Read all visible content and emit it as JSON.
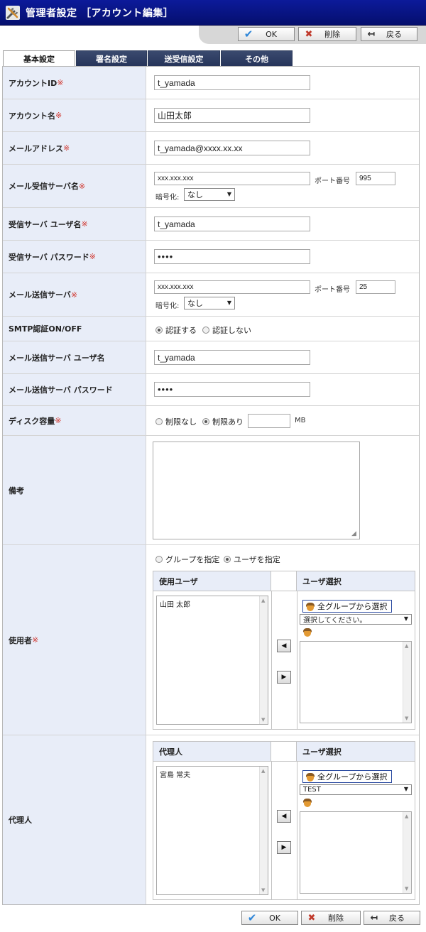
{
  "header": {
    "title": "管理者設定 ［アカウント編集］",
    "icon": "tools-icon"
  },
  "toolbar": {
    "ok": "OK",
    "delete": "削除",
    "back": "戻る"
  },
  "tabs": [
    {
      "label": "基本設定",
      "active": true
    },
    {
      "label": "署名設定",
      "active": false
    },
    {
      "label": "送受信設定",
      "active": false
    },
    {
      "label": "その他",
      "active": false
    }
  ],
  "required_mark": "※",
  "fields": {
    "account_id": {
      "label": "アカウントID",
      "value": "t_yamada"
    },
    "account_name": {
      "label": "アカウント名",
      "value": "山田太郎"
    },
    "email": {
      "label": "メールアドレス",
      "value": "t_yamada@xxxx.xx.xx"
    },
    "pop_server": {
      "label": "メール受信サーバ名",
      "value": "xxx.xxx.xxx",
      "port_label": "ポート番号",
      "port": "995",
      "enc_label": "暗号化:",
      "enc_value": "なし"
    },
    "pop_user": {
      "label": "受信サーバ ユーザ名",
      "value": "t_yamada"
    },
    "pop_pass": {
      "label": "受信サーバ パスワード",
      "value": "••••"
    },
    "smtp_server": {
      "label": "メール送信サーバ",
      "value": "xxx.xxx.xxx",
      "port_label": "ポート番号",
      "port": "25",
      "enc_label": "暗号化:",
      "enc_value": "なし"
    },
    "smtp_auth": {
      "label": "SMTP認証ON/OFF",
      "opt_on": "認証する",
      "opt_off": "認証しない"
    },
    "smtp_user": {
      "label": "メール送信サーバ ユーザ名",
      "value": "t_yamada"
    },
    "smtp_pass": {
      "label": "メール送信サーバ パスワード",
      "value": "••••"
    },
    "disk": {
      "label": "ディスク容量",
      "opt_none": "制限なし",
      "opt_limit": "制限あり",
      "value": "",
      "unit": "MB"
    },
    "note": {
      "label": "備考",
      "value": ""
    },
    "users": {
      "label": "使用者",
      "opt_group": "グループを指定",
      "opt_user": "ユーザを指定",
      "left_header": "使用ユーザ",
      "right_header": "ユーザ選択",
      "selected": [
        "山田 太郎"
      ],
      "group_button": "全グループから選択",
      "group_select": "選択してください。"
    },
    "proxy": {
      "label": "代理人",
      "left_header": "代理人",
      "right_header": "ユーザ選択",
      "selected": [
        "宮島 常夫"
      ],
      "group_button": "全グループから選択",
      "group_select": "TEST"
    }
  }
}
